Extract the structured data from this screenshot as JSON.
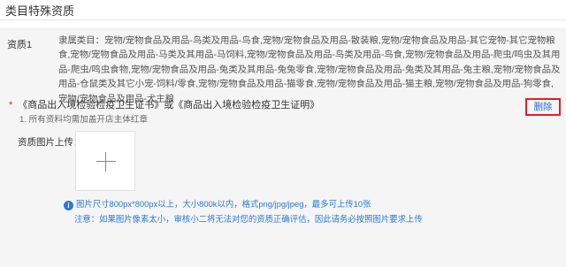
{
  "page": {
    "title": "类目特殊资质"
  },
  "qualification": {
    "label": "资质1",
    "category_prefix": "隶属类目：",
    "category_text": "宠物/宠物食品及用品-鸟类及用品-鸟食,宠物/宠物食品及用品-散装粮,宠物/宠物食品及用品-其它宠物-其它宠物粮食,宠物/宠物食品及用品-马类及其用品-马饲料,宠物/宠物食品及用品-鸟类及用品-鸟食,宠物/宠物食品及用品-爬虫/鸣虫及其用品-爬虫/鸣虫食物,宠物/宠物食品及用品-兔类及其用品-兔兔零食,宠物/宠物食品及用品-兔类及其用品-兔主粮,宠物/宠物食品及用品-仓鼠类及其它小宠-饲料/零食,宠物/宠物食品及用品-猫零食,宠物/宠物食品及用品-猫主粮,宠物/宠物食品及用品-狗零食,宠物/宠物食品及用品-犬主粮",
    "delete_label": "删除",
    "required_mark": "*",
    "required_text": "《商品出入境检验检疫卫生证书》或《商品出入境检验检疫卫生证明》",
    "note": "1. 所有资料均需加盖开店主体红章",
    "upload_label": "资质图片上传：",
    "tip_icon": "i",
    "tip_text": "图片尺寸800px*800px以上，大小800k以内，格式png/jpg/jpeg，最多可上传10张",
    "warning_text": "注意：如果图片像素太小，审核小二将无法对您的资质正确评估，因此请务必按照图片要求上传"
  }
}
